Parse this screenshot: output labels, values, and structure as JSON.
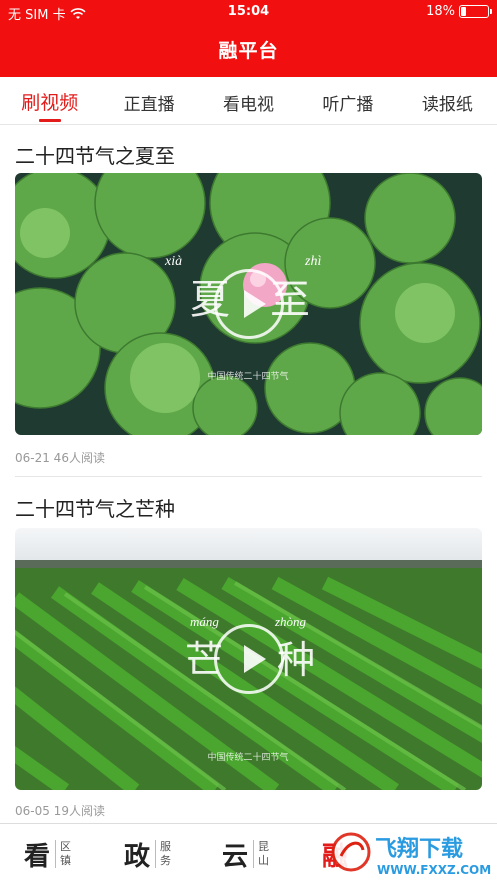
{
  "status_bar": {
    "carrier": "无 SIM 卡",
    "time": "15:04",
    "battery_text": "18%",
    "battery_level": 0.18
  },
  "header": {
    "title": "融平台",
    "accent_color": "#f20f0f"
  },
  "tabs": [
    {
      "label": "刷视频",
      "active": true
    },
    {
      "label": "正直播",
      "active": false
    },
    {
      "label": "看电视",
      "active": false
    },
    {
      "label": "听广播",
      "active": false
    },
    {
      "label": "读报纸",
      "active": false
    }
  ],
  "feed": [
    {
      "title": "二十四节气之夏至",
      "meta": "06-21 46人阅读",
      "overlay": {
        "pinyin1": "xià",
        "pinyin2": "zhì",
        "char1": "夏",
        "char2": "至",
        "caption": "中国传统二十四节气"
      }
    },
    {
      "title": "二十四节气之芒种",
      "meta": "06-05 19人阅读",
      "overlay": {
        "pinyin1": "máng",
        "pinyin2": "zhòng",
        "char1": "芒",
        "char2": "种",
        "caption": "中国传统二十四节气"
      }
    }
  ],
  "bottom_nav": [
    {
      "big": "看",
      "sub": "区镇"
    },
    {
      "big": "政",
      "sub": "服务"
    },
    {
      "big": "云",
      "sub": "昆山"
    },
    {
      "big": "融",
      "sub": ""
    }
  ],
  "watermark": {
    "text": "飞翔下载",
    "url_text": "WWW.FXXZ.COM"
  }
}
